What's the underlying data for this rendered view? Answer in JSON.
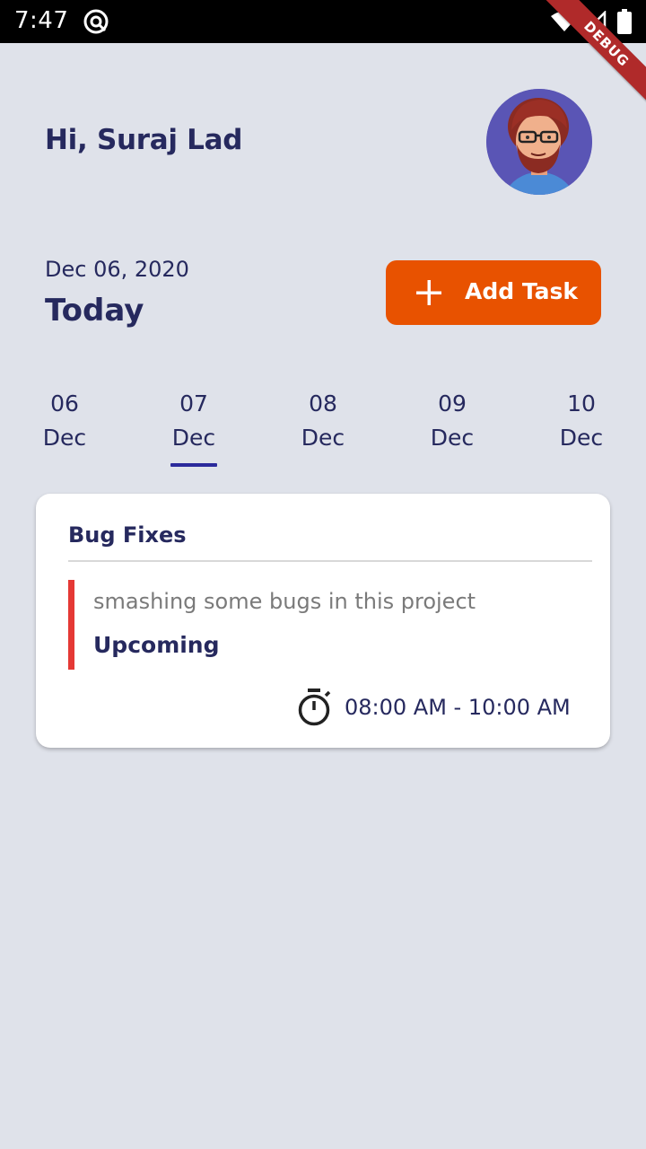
{
  "status_bar": {
    "time": "7:47",
    "icons": [
      "app-notification-icon",
      "wifi-icon",
      "signal-icon",
      "battery-icon"
    ]
  },
  "debug_banner": {
    "label": "DEBUG"
  },
  "header": {
    "greeting": "Hi, Suraj Lad",
    "avatar_icon": "avatar-illustration"
  },
  "date_section": {
    "date": "Dec 06, 2020",
    "today_label": "Today",
    "add_task_label": "Add Task"
  },
  "date_strip": {
    "selected_index": 1,
    "items": [
      {
        "day": "06",
        "month": "Dec"
      },
      {
        "day": "07",
        "month": "Dec"
      },
      {
        "day": "08",
        "month": "Dec"
      },
      {
        "day": "09",
        "month": "Dec"
      },
      {
        "day": "10",
        "month": "Dec"
      }
    ]
  },
  "task": {
    "title": "Bug Fixes",
    "description": "smashing some bugs in this project",
    "status": "Upcoming",
    "time": "08:00 AM - 10:00 AM",
    "accent_color": "#e53935"
  },
  "colors": {
    "background": "#dfe2ea",
    "primary_text": "#26295e",
    "accent_orange": "#e85200",
    "underline": "#2b2a9c"
  }
}
